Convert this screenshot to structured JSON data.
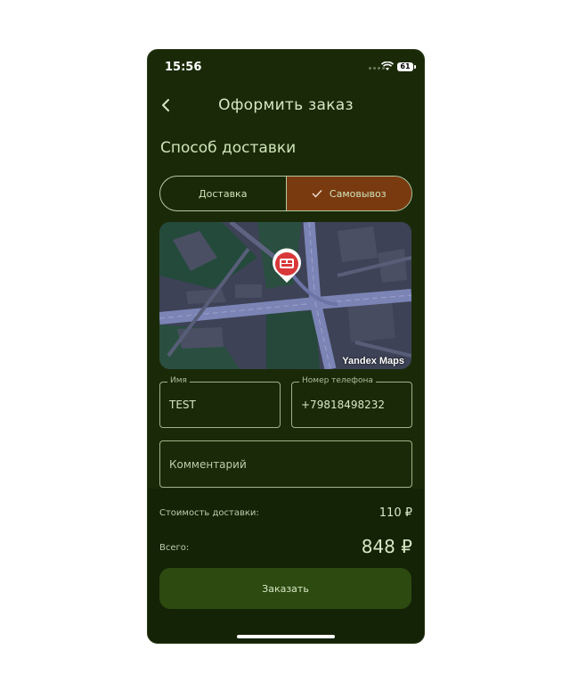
{
  "status_bar": {
    "time": "15:56",
    "battery": "61"
  },
  "header": {
    "title": "Оформить заказ"
  },
  "delivery": {
    "section_title": "Способ доставки",
    "options": [
      {
        "label": "Доставка",
        "selected": false
      },
      {
        "label": "Самовывоз",
        "selected": true
      }
    ]
  },
  "map": {
    "brand": "Yandex Maps"
  },
  "form": {
    "name": {
      "label": "Имя",
      "value": "TEST"
    },
    "phone": {
      "label": "Номер телефона",
      "value": "+79818498232"
    },
    "comment": {
      "placeholder": "Комментарий"
    }
  },
  "summary": {
    "delivery_cost_label": "Стоимость доставки:",
    "delivery_cost_value": "110 ₽",
    "total_label": "Всего:",
    "total_value": "848 ₽"
  },
  "order_button": {
    "label": "Заказать"
  },
  "colors": {
    "background": "#1a2a09",
    "accent": "#7a3a10",
    "button": "#2d4a10",
    "text": "#d7e8c4"
  }
}
